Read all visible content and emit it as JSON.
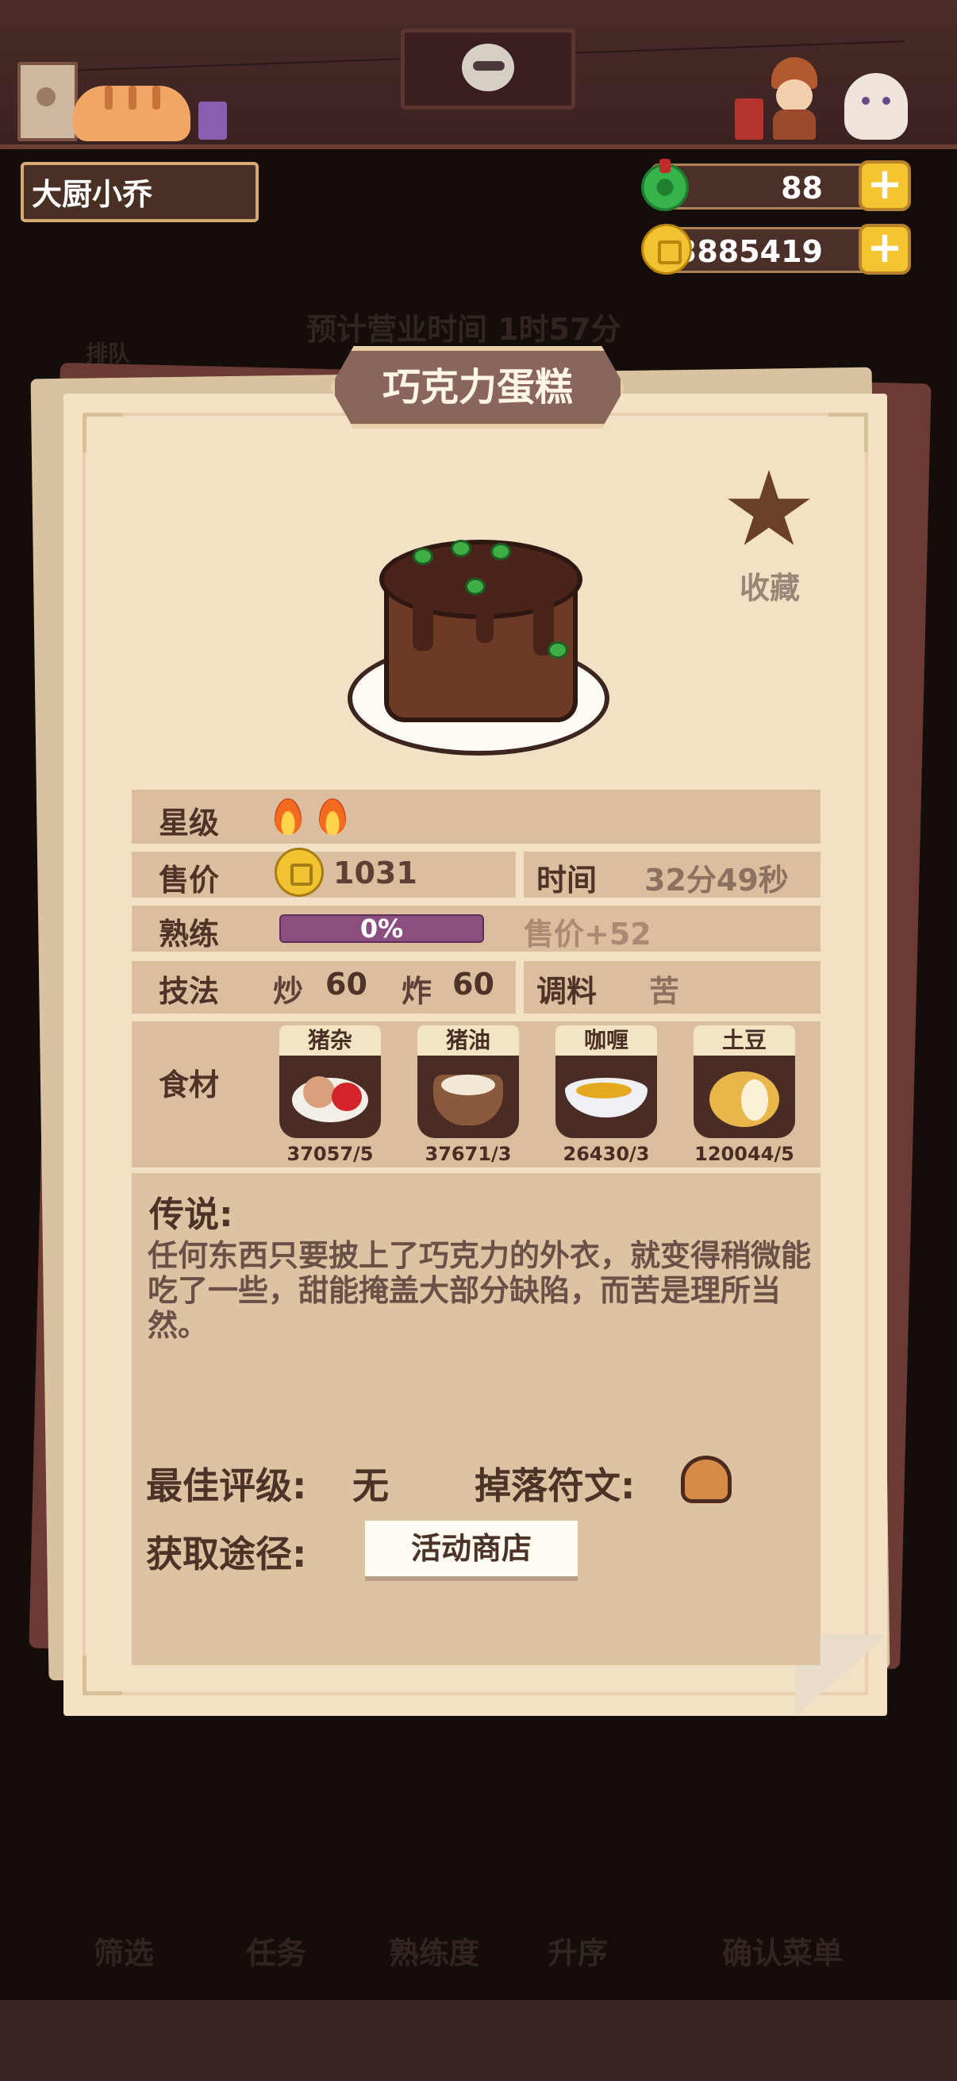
{
  "header": {
    "player_name": "大厨小乔",
    "jade_amount": "88",
    "coin_amount": "3885419",
    "plus_symbol": "+"
  },
  "background": {
    "business_time": "预计营业时间  1时57分",
    "queue_label": "排队",
    "bottom_tabs": [
      "筛选",
      "任务",
      "熟练度",
      "升序",
      "确认菜单"
    ]
  },
  "dish": {
    "name": "巧克力蛋糕",
    "favorite_label": "收藏",
    "stats": {
      "star_label": "星级",
      "star_count": 2,
      "price_label": "售价",
      "price": "1031",
      "time_label": "时间",
      "time": "32分49秒",
      "mastery_label": "熟练",
      "mastery_percent": "0%",
      "mastery_value": 0,
      "mastery_bonus": "售价+52",
      "skill_label": "技法",
      "skills": [
        {
          "name": "炒",
          "value": "60"
        },
        {
          "name": "炸",
          "value": "60"
        }
      ],
      "seasoning_label": "调料",
      "seasoning": "苦"
    },
    "ingredients_label": "食材",
    "ingredients": [
      {
        "name": "猪杂",
        "count": "37057/5",
        "icon": "offal-icon"
      },
      {
        "name": "猪油",
        "count": "37671/3",
        "icon": "lard-icon"
      },
      {
        "name": "咖喱",
        "count": "26430/3",
        "icon": "curry-icon"
      },
      {
        "name": "土豆",
        "count": "120044/5",
        "icon": "potato-icon"
      }
    ],
    "legend_title": "传说:",
    "legend_text": "任何东西只要披上了巧克力的外衣，就变得稍微能吃了一些，甜能掩盖大部分缺陷，而苦是理所当然。",
    "best_rating_label": "最佳评级:",
    "best_rating": "无",
    "rune_label": "掉落符文:",
    "source_label": "获取途径:",
    "source_button": "活动商店"
  },
  "colors": {
    "page_bg": "#140d0a",
    "paper": "#f2e1c4",
    "row": "#dbbe9d",
    "accent_gold": "#f4c531",
    "progress": "#8a4f7e"
  }
}
